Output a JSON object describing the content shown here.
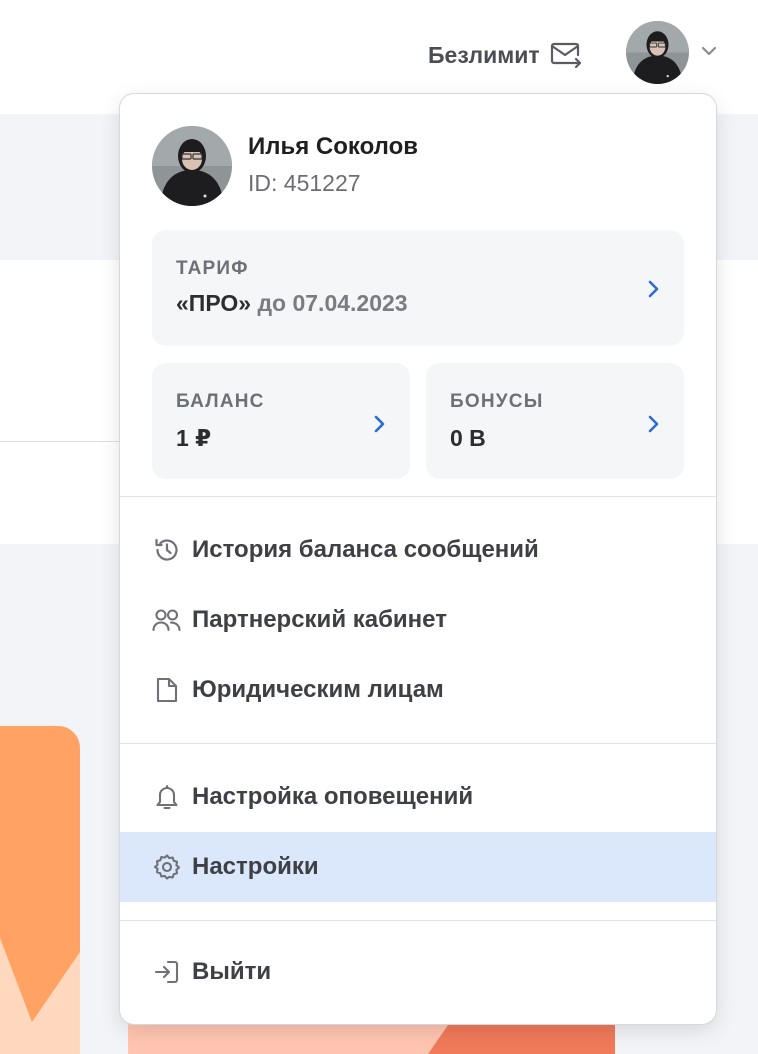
{
  "header": {
    "plan_label": "Безлимит",
    "plan_icon": "mail-forward-icon",
    "avatar_alt": "avatar",
    "dropdown_icon": "chevron-down-icon"
  },
  "profile": {
    "name": "Илья Соколов",
    "id_text": "ID: 451227"
  },
  "tariff": {
    "label": "ТАРИФ",
    "plan": "«ПРО»",
    "until": "до 07.04.2023"
  },
  "balance": {
    "label": "БАЛАНС",
    "value": "1 ₽"
  },
  "bonuses": {
    "label": "БОНУСЫ",
    "value": "0 B"
  },
  "menu_group_1": [
    {
      "label": "История баланса сообщений",
      "icon": "history-icon"
    },
    {
      "label": "Партнерский кабинет",
      "icon": "users-icon"
    },
    {
      "label": "Юридическим лицам",
      "icon": "document-icon"
    }
  ],
  "menu_group_2": [
    {
      "label": "Настройка оповещений",
      "icon": "bell-icon"
    },
    {
      "label": "Настройки",
      "icon": "gear-icon",
      "active": true
    }
  ],
  "logout": {
    "label": "Выйти",
    "icon": "logout-icon"
  },
  "colors": {
    "accent": "#2d6bcf",
    "active_bg": "#dbe7fb",
    "card_bg": "#f5f6f8",
    "orange": "#ffa264"
  }
}
